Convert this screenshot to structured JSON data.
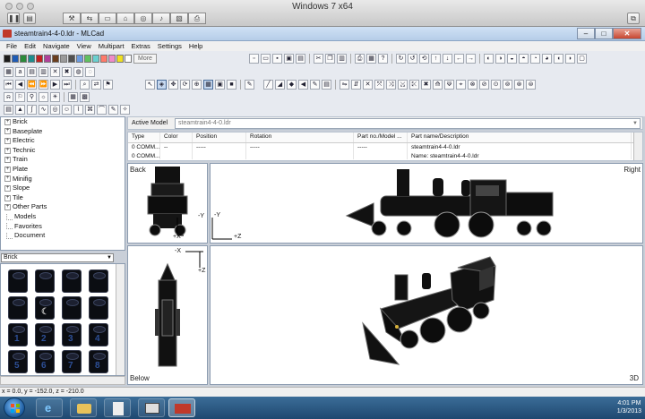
{
  "host": {
    "title": "Windows 7 x64"
  },
  "window": {
    "title": "steamtrain4-4-0.ldr - MLCad"
  },
  "menu": [
    "File",
    "Edit",
    "Navigate",
    "View",
    "Multipart",
    "Extras",
    "Settings",
    "Help"
  ],
  "toolbar": {
    "more_label": "More",
    "colors": [
      "#1b1b1b",
      "#1e5bb5",
      "#2a8a3a",
      "#1d8d8d",
      "#c02020",
      "#b0409a",
      "#6a3e1e",
      "#9a9a9a",
      "#505050",
      "#6a9ae0",
      "#60c060",
      "#6ad0d0",
      "#ff7a6a",
      "#f08ac8",
      "#f0e020",
      "#ffffff"
    ]
  },
  "tree": {
    "items": [
      {
        "label": "Brick",
        "expandable": true
      },
      {
        "label": "Baseplate",
        "expandable": true
      },
      {
        "label": "Electric",
        "expandable": true
      },
      {
        "label": "Technic",
        "expandable": true
      },
      {
        "label": "Train",
        "expandable": true
      },
      {
        "label": "Plate",
        "expandable": true
      },
      {
        "label": "Minifig",
        "expandable": true
      },
      {
        "label": "Slope",
        "expandable": true
      },
      {
        "label": "Tile",
        "expandable": true
      },
      {
        "label": "Other Parts",
        "expandable": true
      },
      {
        "label": "Models",
        "expandable": false
      },
      {
        "label": "Favorites",
        "expandable": false
      },
      {
        "label": "Document",
        "expandable": false
      }
    ]
  },
  "palette": {
    "category": "Brick"
  },
  "model": {
    "active_label": "Active Model",
    "active_value": "steamtrain4-4-0.ldr",
    "columns": [
      "Type",
      "Color",
      "Position",
      "Rotation",
      "Part no./Model ...",
      "Part name/Description"
    ],
    "rows": [
      [
        "0 COMM...",
        "--",
        "-----",
        "-----",
        "-----",
        "steamtrain4-4-0.ldr"
      ],
      [
        "0 COMM...",
        "",
        "",
        "",
        "",
        "Name: steamtrain4-4-0.ldr"
      ]
    ]
  },
  "views": {
    "back": "Back",
    "right": "Right",
    "below": "Below",
    "threed": "3D",
    "axes": {
      "back_x": "+X",
      "back_y": "-Y",
      "right_y": "-Y",
      "right_z": "+Z",
      "below_x": "-X",
      "below_z": "+Z"
    }
  },
  "status": {
    "coords": "x = 0.0, y = -152.0, z = -210.0"
  },
  "taskbar": {
    "time": "4:01 PM",
    "date": "1/3/2013"
  }
}
